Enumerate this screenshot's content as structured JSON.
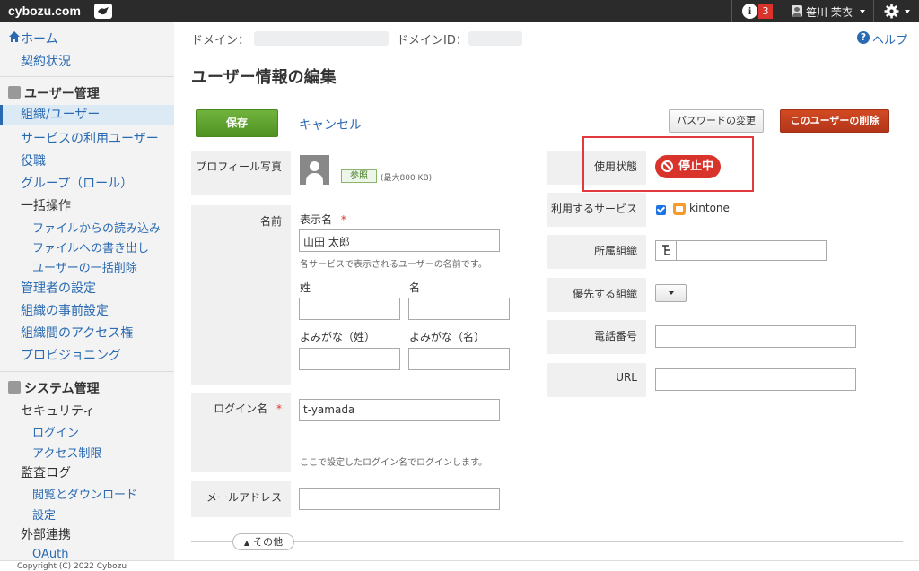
{
  "topbar": {
    "brand": "cybozu.com",
    "notification_count": "3",
    "user_name": "笹川 茉衣"
  },
  "sidebar": {
    "home": "ホーム",
    "contract": "契約状況",
    "user_mgmt_heading": "ユーザー管理",
    "org_users": "組織/ユーザー",
    "service_users": "サービスの利用ユーザー",
    "roles": "役職",
    "groups": "グループ（ロール）",
    "bulk_ops": "一括操作",
    "import": "ファイルからの読み込み",
    "export": "ファイルへの書き出し",
    "bulk_delete": "ユーザーの一括削除",
    "admin_settings": "管理者の設定",
    "org_presets": "組織の事前設定",
    "org_access": "組織間のアクセス権",
    "provisioning": "プロビジョニング",
    "system_heading": "システム管理",
    "security": "セキュリティ",
    "login": "ログイン",
    "access_limit": "アクセス制限",
    "audit_log": "監査ログ",
    "view_download": "閲覧とダウンロード",
    "settings": "設定",
    "external": "外部連携",
    "oauth": "OAuth"
  },
  "footer": {
    "copyright": "Copyright (C) 2022 Cybozu"
  },
  "main": {
    "domain_label": "ドメイン：",
    "domain_id_label": "ドメインID：",
    "help": "ヘルプ",
    "page_title": "ユーザー情報の編集",
    "save": "保存",
    "cancel": "キャンセル",
    "change_password": "パスワードの変更",
    "delete_user": "このユーザーの削除",
    "profile_photo_label": "プロフィール写真",
    "browse": "参照",
    "max_size": "(最大800 KB)",
    "name_label": "名前",
    "display_name_label": "表示名",
    "required_mark": "*",
    "display_name_value": "山田 太郎",
    "display_name_hint": "各サービスで表示されるユーザーの名前です。",
    "last_name": "姓",
    "first_name": "名",
    "last_name_kana": "よみがな（姓）",
    "first_name_kana": "よみがな（名）",
    "login_name_label": "ログイン名",
    "login_name_value": "t-yamada",
    "login_name_hint": "ここで設定したログイン名でログインします。",
    "email_label": "メールアドレス",
    "more": "その他",
    "status_label": "使用状態",
    "status_value": "停止中",
    "services_label": "利用するサービス",
    "service_kintone": "kintone",
    "org_label": "所属組織",
    "priority_org_label": "優先する組織",
    "phone_label": "電話番号",
    "url_label": "URL"
  }
}
